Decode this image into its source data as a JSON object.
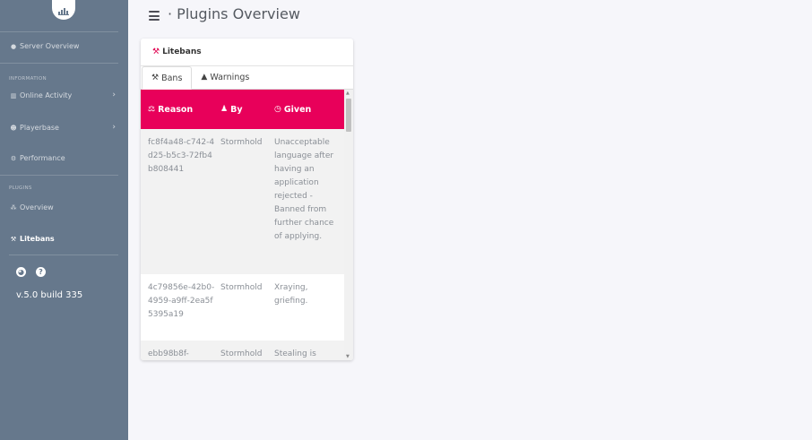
{
  "sidebar": {
    "logo_icon": "bar-chart-logo",
    "items": {
      "server_overview": {
        "label": "Server Overview",
        "icon": "circle-icon"
      },
      "online_activity": {
        "label": "Online Activity",
        "icon": "bar-chart-icon"
      },
      "playerbase": {
        "label": "Playerbase",
        "icon": "users-icon"
      },
      "performance": {
        "label": "Performance",
        "icon": "cogs-icon"
      },
      "overview": {
        "label": "Overview",
        "icon": "cubes-icon"
      },
      "litebans": {
        "label": "Litebans",
        "icon": "gavel-icon"
      }
    },
    "sections": {
      "information": "INFORMATION",
      "plugins": "PLUGINS"
    },
    "footer_icons": [
      "palette-icon",
      "question-icon"
    ],
    "version": "v.5.0 build 335",
    "colors": {
      "background": "#66788c"
    }
  },
  "header": {
    "title": "· Plugins Overview"
  },
  "card": {
    "title": "Litebans",
    "tabs": [
      {
        "label": "Bans",
        "icon": "gavel-icon",
        "active": true
      },
      {
        "label": "Warnings",
        "icon": "warning-icon",
        "active": false
      }
    ],
    "table": {
      "headers": {
        "reason": "Reason",
        "by": "By",
        "given": "Given"
      },
      "rows": [
        {
          "reason": "fc8f4a48-c742-4d25-b5c3-72fb4b808441",
          "by": "Stormhold",
          "given": "Unacceptable language after having an application rejected - Banned from further chance of applying."
        },
        {
          "reason": "4c79856e-42b0-4959-a9ff-2ea5f5395a19",
          "by": "Stormhold",
          "given": "Xraying, griefing."
        },
        {
          "reason": "ebb98b8f-",
          "by": "Stormhold",
          "given": "Stealing is"
        }
      ]
    },
    "colors": {
      "accent": "#e8005a"
    }
  }
}
